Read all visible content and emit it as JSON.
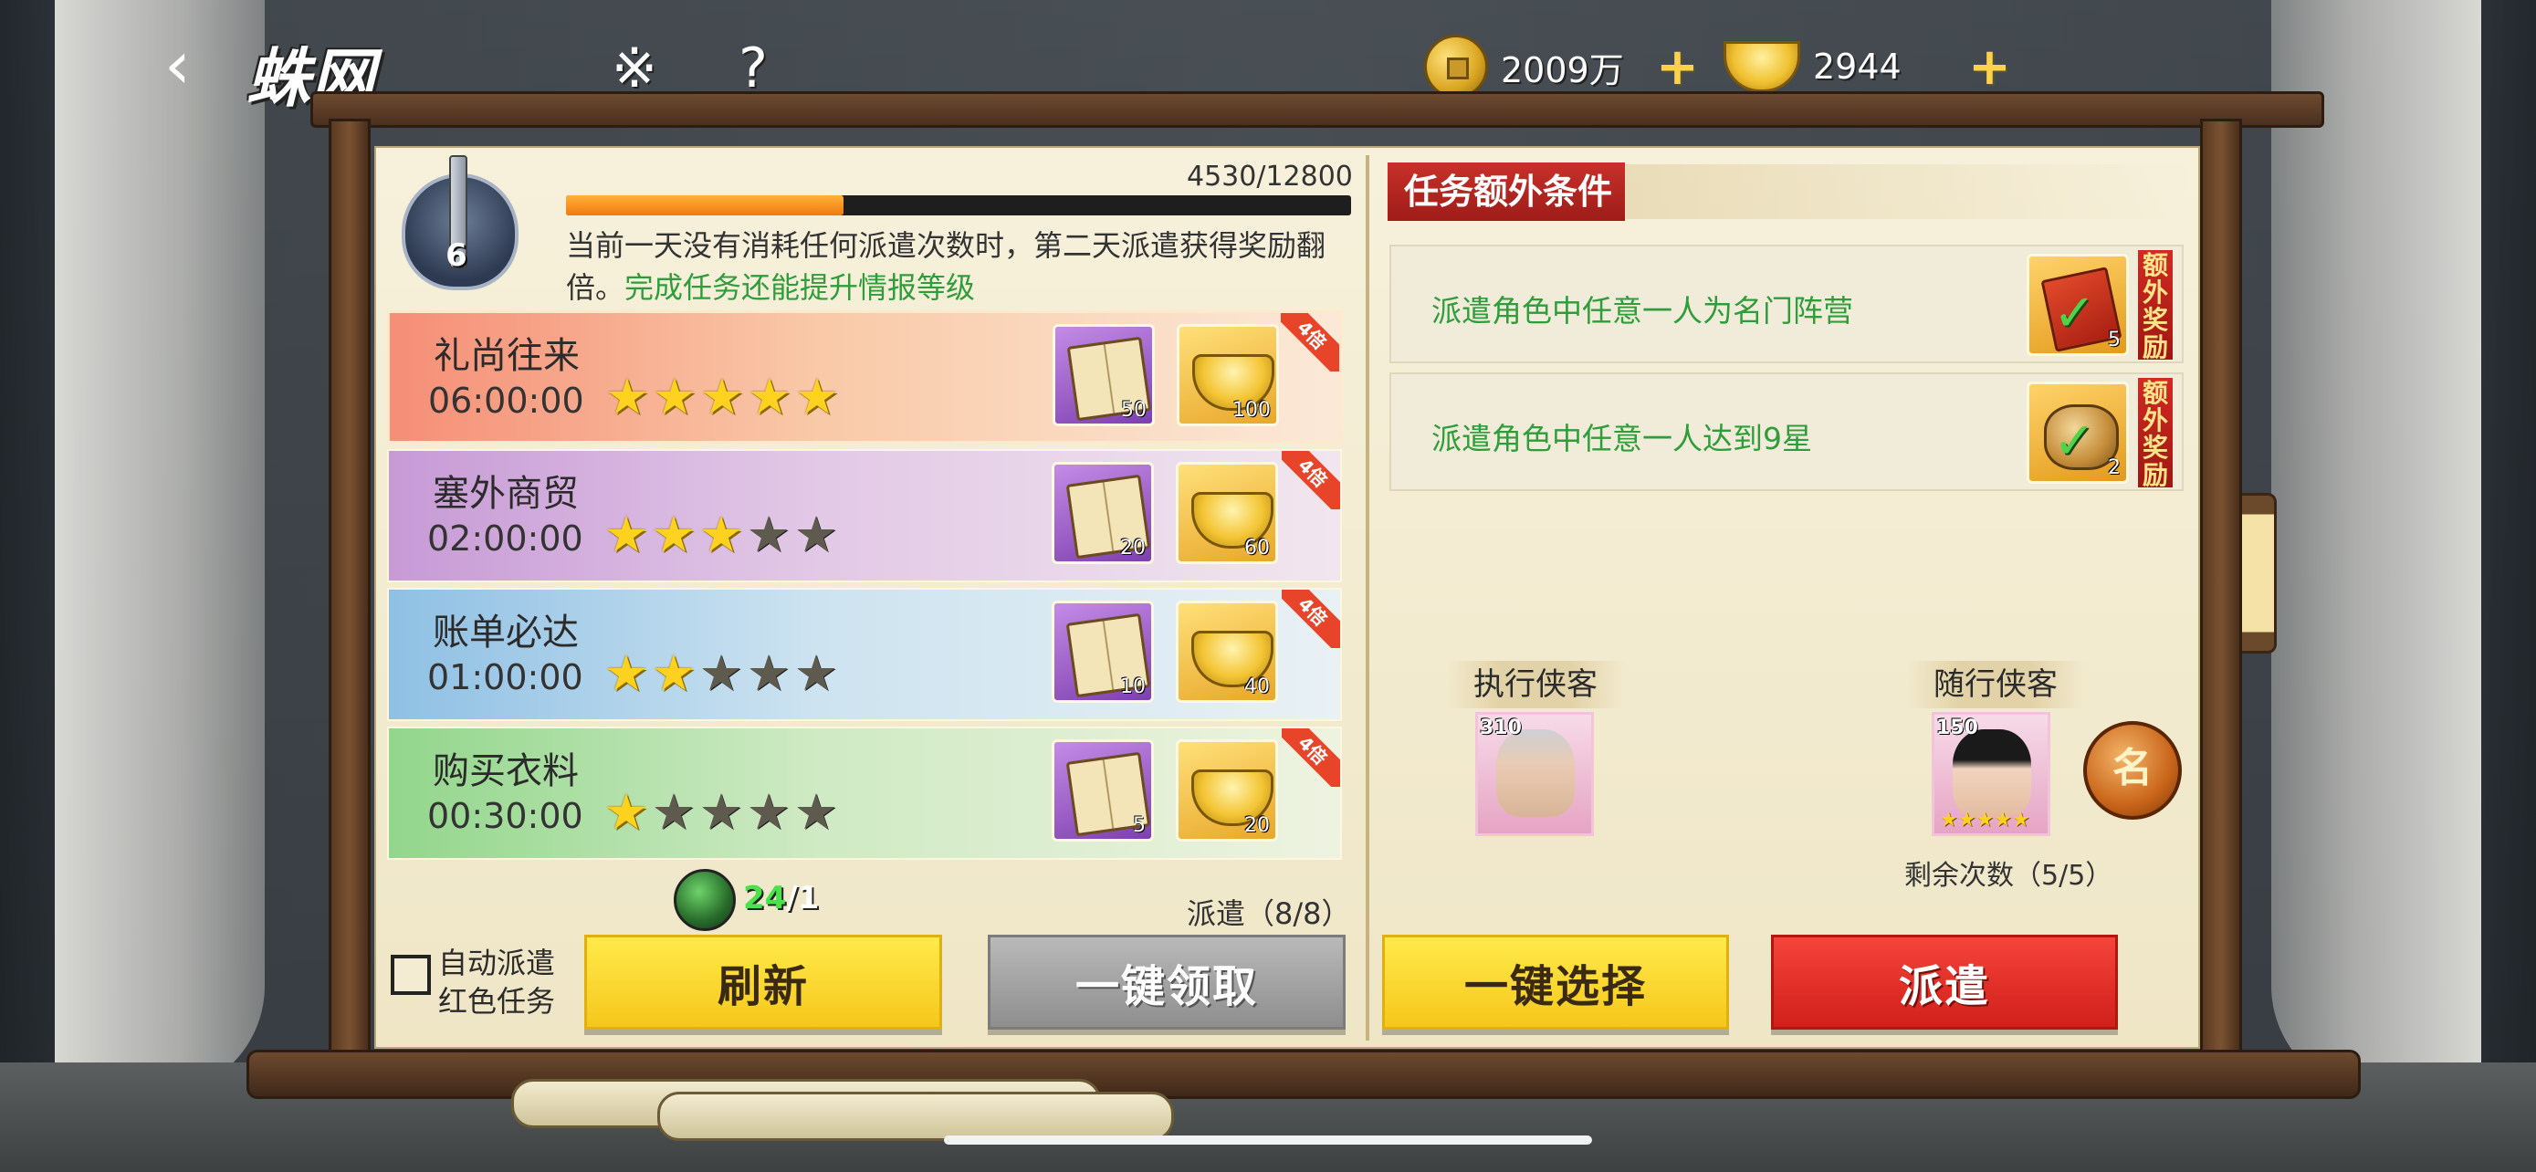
{
  "header": {
    "back_icon": "chevron-left-icon",
    "title": "蛛网",
    "tool_icon": "scroll-symbol-icon",
    "help_label": "?"
  },
  "currency": {
    "copper": {
      "icon": "copper-coin-icon",
      "value": "2009万"
    },
    "gold": {
      "icon": "gold-ingot-icon",
      "value": "2944"
    },
    "plus_label": "+"
  },
  "intel": {
    "level": "6",
    "progress_text": "4530/12800",
    "progress": 0.354
  },
  "description": {
    "main": "当前一天没有消耗任何派遣次数时，第二天派遣获得奖励翻倍。",
    "highlight": "完成任务还能提升情报等级"
  },
  "tasks": [
    {
      "name": "礼尚往来",
      "time": "06:00:00",
      "stars": 5,
      "bonus": "4倍",
      "rewards": [
        {
          "type": "book",
          "count": "50"
        },
        {
          "type": "gold-ingot",
          "count": "100"
        }
      ]
    },
    {
      "name": "塞外商贸",
      "time": "02:00:00",
      "stars": 3,
      "bonus": "4倍",
      "rewards": [
        {
          "type": "book",
          "count": "20"
        },
        {
          "type": "gold-ingot",
          "count": "60"
        }
      ]
    },
    {
      "name": "账单必达",
      "time": "01:00:00",
      "stars": 2,
      "bonus": "4倍",
      "rewards": [
        {
          "type": "book",
          "count": "10"
        },
        {
          "type": "gold-ingot",
          "count": "40"
        }
      ]
    },
    {
      "name": "购买衣料",
      "time": "00:30:00",
      "stars": 1,
      "bonus": "4倍",
      "rewards": [
        {
          "type": "book",
          "count": "5"
        },
        {
          "type": "gold-ingot",
          "count": "20"
        }
      ]
    }
  ],
  "stamina": {
    "current": "24",
    "separator": "/",
    "max": "1"
  },
  "dispatch_count": "派遣（8/8）",
  "auto_dispatch": {
    "label_line1": "自动派遣",
    "label_line2": "红色任务",
    "checked": false
  },
  "buttons": {
    "refresh": "刷新",
    "collect_all": "一键领取",
    "select_all": "一键选择",
    "dispatch": "派遣"
  },
  "conditions": {
    "header": "任务额外条件",
    "items": [
      {
        "text": "派遣角色中任意一人为名门阵营",
        "reward_count": "5",
        "tag": "额外奖励"
      },
      {
        "text": "派遣角色中任意一人达到9星",
        "reward_count": "2",
        "tag": "额外奖励"
      }
    ]
  },
  "heroes": {
    "executor_label": "执行侠客",
    "follower_label": "随行侠客",
    "executor": {
      "level": "310"
    },
    "follower": {
      "level": "150",
      "stars": 5
    },
    "faction_badge": "名",
    "remaining": "剩余次数（5/5）"
  }
}
